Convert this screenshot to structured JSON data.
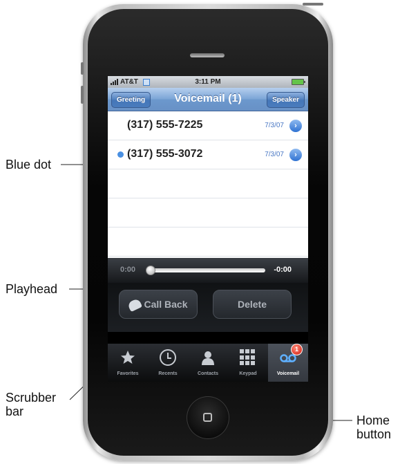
{
  "status_bar": {
    "carrier": "AT&T",
    "time": "3:11 PM"
  },
  "nav_bar": {
    "left_button": "Greeting",
    "title": "Voicemail (1)",
    "right_button": "Speaker"
  },
  "voicemails": [
    {
      "number": "(317) 555-7225",
      "date": "7/3/07",
      "unheard": false
    },
    {
      "number": "(317) 555-3072",
      "date": "7/3/07",
      "unheard": true
    }
  ],
  "scrubber": {
    "elapsed": "0:00",
    "remaining": "-0:00",
    "progress": 0
  },
  "actions": {
    "call_back": "Call Back",
    "delete": "Delete"
  },
  "tabs": [
    {
      "label": "Favorites",
      "icon": "star-icon"
    },
    {
      "label": "Recents",
      "icon": "clock-icon"
    },
    {
      "label": "Contacts",
      "icon": "person-icon"
    },
    {
      "label": "Keypad",
      "icon": "keypad-icon"
    },
    {
      "label": "Voicemail",
      "icon": "voicemail-icon",
      "badge": "1",
      "active": true
    }
  ],
  "callouts": {
    "blue_dot": "Blue dot",
    "playhead": "Playhead",
    "scrubber_bar": "Scrubber bar",
    "home_button": "Home button"
  },
  "colors": {
    "nav_blue": "#6c98cd",
    "unheard_dot": "#4a90e2",
    "badge_red": "#d21b0c",
    "date_blue": "#4a78c4"
  }
}
